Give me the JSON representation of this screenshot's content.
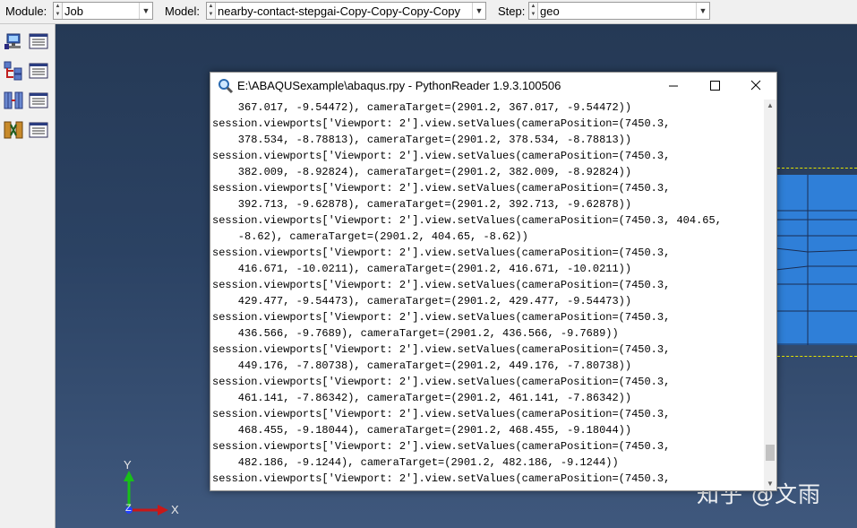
{
  "context_bar": {
    "module_label": "Module:",
    "module_value": "Job",
    "model_label": "Model:",
    "model_value": "nearby-contact-stepgai-Copy-Copy-Copy-Copy",
    "step_label": "Step:",
    "step_value": "geo"
  },
  "toolbox": {
    "tools": [
      {
        "icon": "job-manager-icon"
      },
      {
        "icon": "job-list-icon"
      },
      {
        "icon": "adaptivity-icon"
      },
      {
        "icon": "adaptivity-list-icon"
      },
      {
        "icon": "co-execution-icon"
      },
      {
        "icon": "co-execution-list-icon"
      },
      {
        "icon": "optimization-icon"
      },
      {
        "icon": "optimization-list-icon"
      }
    ]
  },
  "viewport": {
    "triad": {
      "y_label": "Y",
      "x_label": "X",
      "z_label": "Z"
    },
    "watermark": "知乎 @文雨",
    "colors": {
      "part": "#2f7fd8",
      "mesh_edge": "#1b2d52",
      "dashed": "#e4e400"
    }
  },
  "reader_window": {
    "title": "E:\\ABAQUSexample\\abaqus.rpy - PythonReader 1.9.3.100506",
    "title_icon": "magnifier-icon",
    "minimize_icon": "minimize-icon",
    "maximize_icon": "maximize-icon",
    "close_icon": "close-icon",
    "lines": [
      "    367.017, -9.54472), cameraTarget=(2901.2, 367.017, -9.54472))",
      "session.viewports['Viewport: 2'].view.setValues(cameraPosition=(7450.3,",
      "    378.534, -8.78813), cameraTarget=(2901.2, 378.534, -8.78813))",
      "session.viewports['Viewport: 2'].view.setValues(cameraPosition=(7450.3,",
      "    382.009, -8.92824), cameraTarget=(2901.2, 382.009, -8.92824))",
      "session.viewports['Viewport: 2'].view.setValues(cameraPosition=(7450.3,",
      "    392.713, -9.62878), cameraTarget=(2901.2, 392.713, -9.62878))",
      "session.viewports['Viewport: 2'].view.setValues(cameraPosition=(7450.3, 404.65,",
      "    -8.62), cameraTarget=(2901.2, 404.65, -8.62))",
      "session.viewports['Viewport: 2'].view.setValues(cameraPosition=(7450.3,",
      "    416.671, -10.0211), cameraTarget=(2901.2, 416.671, -10.0211))",
      "session.viewports['Viewport: 2'].view.setValues(cameraPosition=(7450.3,",
      "    429.477, -9.54473), cameraTarget=(2901.2, 429.477, -9.54473))",
      "session.viewports['Viewport: 2'].view.setValues(cameraPosition=(7450.3,",
      "    436.566, -9.7689), cameraTarget=(2901.2, 436.566, -9.7689))",
      "session.viewports['Viewport: 2'].view.setValues(cameraPosition=(7450.3,",
      "    449.176, -7.80738), cameraTarget=(2901.2, 449.176, -7.80738))",
      "session.viewports['Viewport: 2'].view.setValues(cameraPosition=(7450.3,",
      "    461.141, -7.86342), cameraTarget=(2901.2, 461.141, -7.86342))",
      "session.viewports['Viewport: 2'].view.setValues(cameraPosition=(7450.3,",
      "    468.455, -9.18044), cameraTarget=(2901.2, 468.455, -9.18044))",
      "session.viewports['Viewport: 2'].view.setValues(cameraPosition=(7450.3,",
      "    482.186, -9.1244), cameraTarget=(2901.2, 482.186, -9.1244))",
      "session.viewports['Viewport: 2'].view.setValues(cameraPosition=(7450.3,"
    ],
    "scroll_position": 0.95
  }
}
